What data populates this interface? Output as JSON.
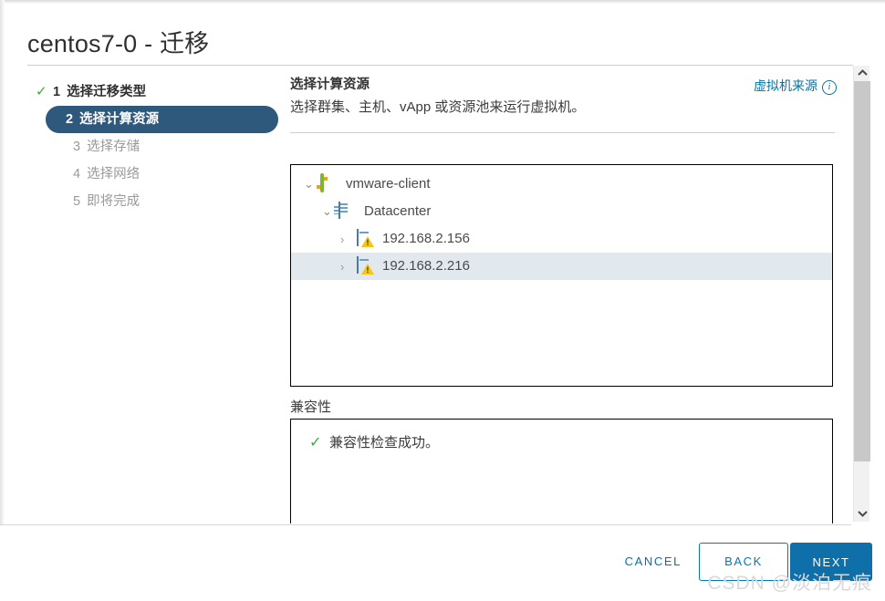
{
  "window": {
    "title": "centos7-0 - 迁移"
  },
  "steps": [
    {
      "num": "1",
      "label": "选择迁移类型",
      "state": "done"
    },
    {
      "num": "2",
      "label": "选择计算资源",
      "state": "active"
    },
    {
      "num": "3",
      "label": "选择存储",
      "state": "pending"
    },
    {
      "num": "4",
      "label": "选择网络",
      "state": "pending"
    },
    {
      "num": "5",
      "label": "即将完成",
      "state": "pending"
    }
  ],
  "content": {
    "heading": "选择计算资源",
    "subheading": "选择群集、主机、vApp 或资源池来运行虚拟机。",
    "source_link": "虚拟机来源",
    "info_icon": "i"
  },
  "tree": [
    {
      "level": 0,
      "caret": "⌄",
      "icon": "vcenter-icon",
      "label": "vmware-client",
      "selected": false
    },
    {
      "level": 1,
      "caret": "⌄",
      "icon": "datacenter-icon",
      "label": "Datacenter",
      "selected": false
    },
    {
      "level": 2,
      "caret": "›",
      "icon": "host-warning-icon",
      "label": "192.168.2.156",
      "selected": false
    },
    {
      "level": 2,
      "caret": "›",
      "icon": "host-warning-icon",
      "label": "192.168.2.216",
      "selected": true
    }
  ],
  "compatibility": {
    "label": "兼容性",
    "check_glyph": "✓",
    "message": "兼容性检查成功。"
  },
  "scrollbar": {
    "up_glyph": "︿",
    "down_glyph": "﹀"
  },
  "footer": {
    "cancel": "CANCEL",
    "back": "BACK",
    "next": "NEXT"
  },
  "watermark": "CSDN @淡泊无痕",
  "colors": {
    "accent_blue": "#0672a3",
    "next_button": "#0f6fa8",
    "active_step": "#2f587d",
    "success_green": "#3aab3a",
    "warning_yellow": "#f5c518",
    "selection": "#e1e8ee",
    "annotation_red": "#fb2c22"
  }
}
